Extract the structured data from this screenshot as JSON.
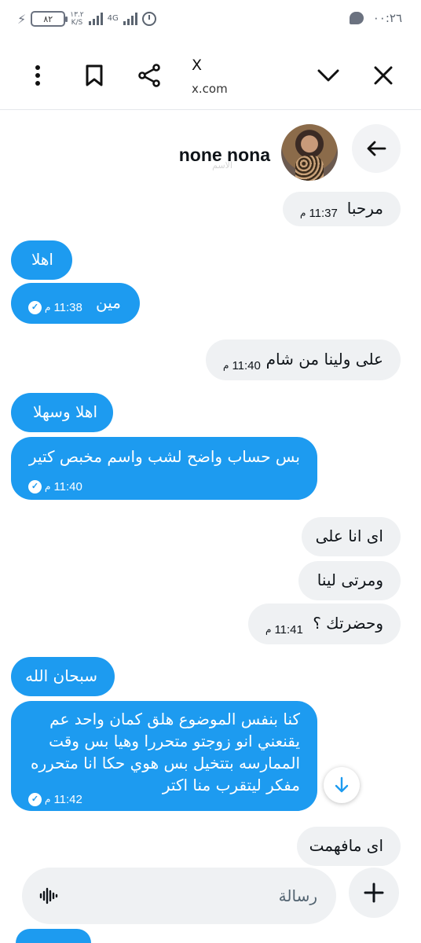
{
  "status_bar": {
    "battery": "٨٢",
    "speed_value": "١٣.٢",
    "speed_unit": "K/S",
    "network": "4G",
    "clock": "٠٠:٢٦"
  },
  "browser": {
    "title": "X",
    "url": "x.com"
  },
  "chat": {
    "name": "none nona",
    "subtitle": "الاسم"
  },
  "messages": [
    {
      "dir": "in",
      "text": "مرحبا",
      "time": "11:37",
      "ampm": "م"
    },
    {
      "dir": "out",
      "text": "اهلا"
    },
    {
      "dir": "out",
      "text": "مين",
      "time": "11:38",
      "ampm": "م"
    },
    {
      "dir": "in",
      "text": "على ولينا من شام",
      "time": "11:40",
      "ampm": "م"
    },
    {
      "dir": "out",
      "text": "اهلا وسهلا"
    },
    {
      "dir": "out",
      "text": "بس حساب واضح لشب واسم مخبص كتير",
      "time": "11:40",
      "ampm": "م"
    },
    {
      "dir": "in",
      "text": "اى انا على"
    },
    {
      "dir": "in",
      "text": "ومرتى لينا"
    },
    {
      "dir": "in",
      "text": "وحضرتك ؟",
      "time": "11:41",
      "ampm": "م"
    },
    {
      "dir": "out",
      "text": "سبحان الله"
    },
    {
      "dir": "out",
      "lines": [
        "كنا بنفس الموضوع هلق كمان واحد عم",
        "يقنعني انو زوجتو متحررا وهيا بس وقت",
        "الممارسه بتتخيل بس هوي حكا انا متحرره",
        "مفكر ليتقرب منا اكتر"
      ],
      "time": "11:42",
      "ampm": "م"
    },
    {
      "dir": "in",
      "text": "اى مافهمت"
    }
  ],
  "composer": {
    "placeholder": "رسالة"
  },
  "colors": {
    "outgoing": "#1d9bf0",
    "incoming": "#eff1f3"
  }
}
